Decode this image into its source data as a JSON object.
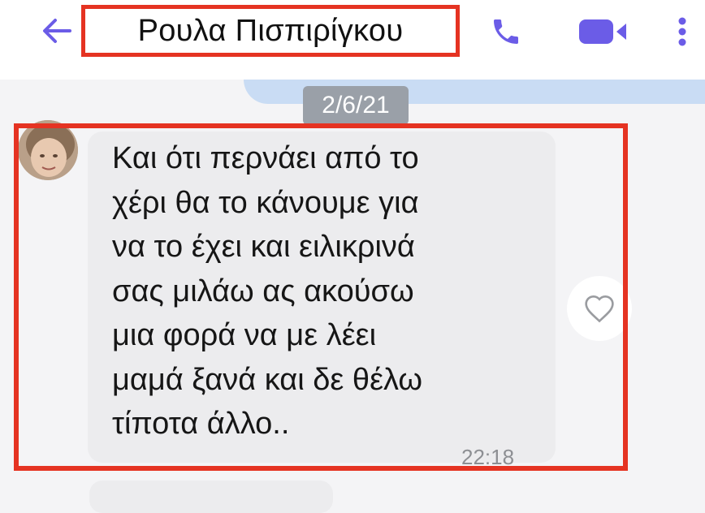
{
  "header": {
    "contact_name": "Ρουλα Πισπιρίγκου",
    "back_icon": "arrow-left-icon",
    "call_icon": "phone-icon",
    "video_icon": "video-camera-icon",
    "more_icon": "more-vertical-icon"
  },
  "chat": {
    "date_label": "2/6/21",
    "message": {
      "text": "Και ότι περνάει από το\nχέρι θα το κάνουμε για\nνα το έχει και ειλικρινά\nσας μιλάω ας ακούσω\nμια φορά να με λέει\nμαμά ξανά και δε θέλω\nτίποτα άλλο..",
      "time": "22:18",
      "like_icon": "heart-outline-icon"
    }
  },
  "colors": {
    "accent": "#6b5ce7",
    "highlight": "#e53322",
    "bubble": "#ececee"
  }
}
